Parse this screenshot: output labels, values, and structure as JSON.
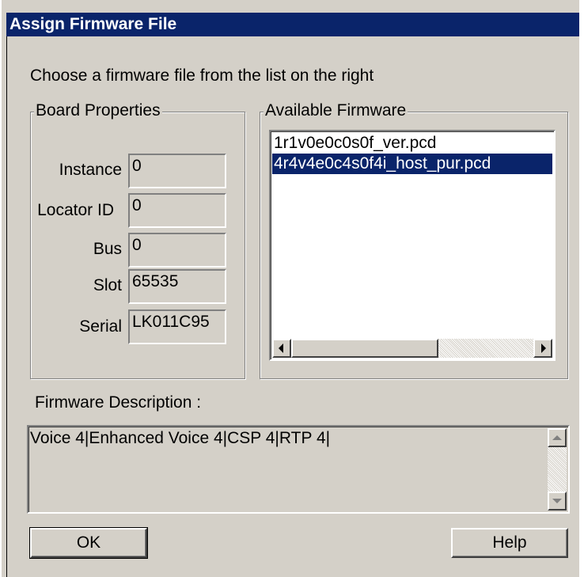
{
  "window": {
    "title": "Assign Firmware File"
  },
  "instruction": "Choose a firmware file from the list on the right",
  "board_properties": {
    "title": "Board Properties",
    "fields": [
      {
        "label": "Instance",
        "value": "0"
      },
      {
        "label": "Locator ID",
        "value": "0"
      },
      {
        "label": "Bus",
        "value": "0"
      },
      {
        "label": "Slot",
        "value": "65535"
      },
      {
        "label": "Serial",
        "value": "LK011C95"
      }
    ]
  },
  "available_firmware": {
    "title": "Available Firmware",
    "items": [
      {
        "name": "1r1v0e0c0s0f_ver.pcd",
        "selected": false
      },
      {
        "name": "4r4v4e0c4s0f4i_host_pur.pcd",
        "selected": true
      }
    ]
  },
  "firmware_description": {
    "label": "Firmware Description :",
    "text": "Voice 4|Enhanced Voice 4|CSP 4|RTP 4|"
  },
  "buttons": {
    "ok": "OK",
    "help": "Help"
  },
  "colors": {
    "titlebar": "#0a246a",
    "dialog_bg": "#d4d0c8",
    "selection": "#0a246a"
  }
}
